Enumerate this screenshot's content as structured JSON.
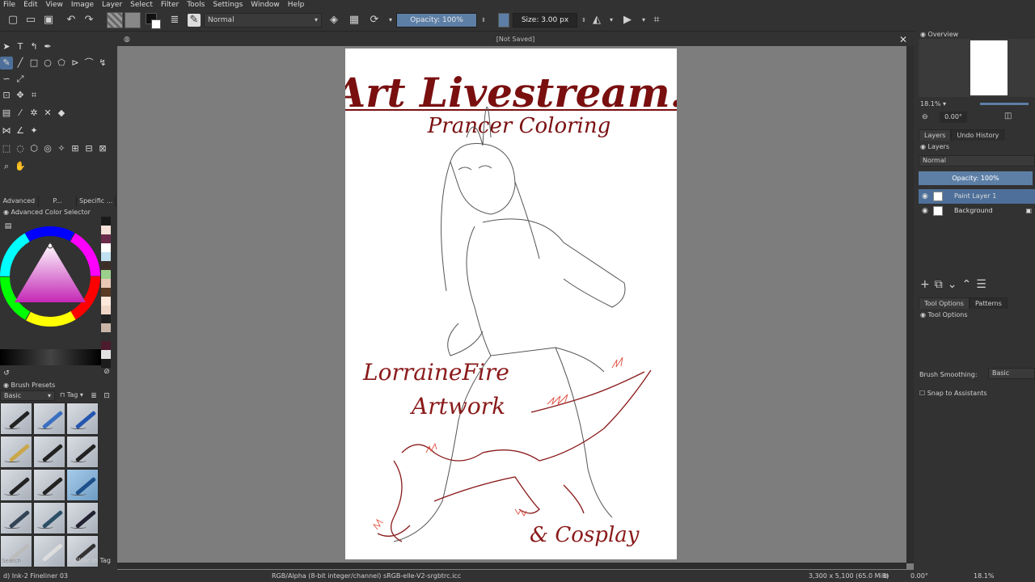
{
  "menu": [
    "File",
    "Edit",
    "View",
    "Image",
    "Layer",
    "Select",
    "Filter",
    "Tools",
    "Settings",
    "Window",
    "Help"
  ],
  "toolbar": {
    "blend_mode": "Normal",
    "opacity_label": "Opacity: 100%",
    "opacity_value": 1.0,
    "size_label": "Size: 3.00 px"
  },
  "left_dock": {
    "tabs": [
      "Advanced ...",
      "P...",
      "Specific ..."
    ],
    "color_selector_title": "Advanced Color Selector",
    "brush_presets_title": "Brush Presets",
    "brush_filter": "Basic",
    "brush_tag": "Tag",
    "search_placeholder": "Search",
    "filter_in_tag": "Filter in Tag",
    "palette_colors": [
      "#1a1a1a",
      "#f5e1d7",
      "#6b2b4a",
      "#ffffff",
      "#bfe0f0",
      "#3d2f28",
      "#9ad08c",
      "#e8c9b5",
      "#5a3b24",
      "#fde9dc",
      "#f0d6c8",
      "#222222",
      "#c9b6a8",
      "#303030",
      "#4d1b2e",
      "#e2e2e2",
      "#1c1c1c"
    ]
  },
  "canvas": {
    "title": "[Not Saved]",
    "art_title": "Art Livestream!",
    "subtitle": "Prancer Coloring",
    "artist_line1": "LorraineFire",
    "artist_line2": "Artwork",
    "cosplay": "& Cosplay"
  },
  "right_dock": {
    "overview_title": "Overview",
    "zoom": "18.1%",
    "rotation": "0.00°",
    "tabs": [
      "Layers",
      "Undo History"
    ],
    "layers_title": "Layers",
    "blend": "Normal",
    "opacity": "Opacity:  100%",
    "layers": [
      {
        "name": "Paint Layer 1",
        "selected": true
      },
      {
        "name": "Background",
        "selected": false
      }
    ],
    "tool_tabs": [
      "Tool Options",
      "Patterns"
    ],
    "tool_options_title": "Tool Options",
    "brush_smoothing_label": "Brush Smoothing:",
    "brush_smoothing_value": "Basic",
    "snap_label": "Snap to Assistants"
  },
  "status": {
    "brush": "d) Ink-2 Fineliner 03",
    "color_profile": "RGB/Alpha (8-bit integer/channel)  sRGB-elle-V2-srgbtrc.icc",
    "dimensions": "3,300 x 5,100 (65.0 MiB)",
    "angle": "0.00°",
    "zoom": "18.1%"
  },
  "colors": {
    "accent": "#4d6f99",
    "title_red": "#7a0f10",
    "bg_dark": "#323232",
    "canvas_bg": "#7d7d7d"
  }
}
